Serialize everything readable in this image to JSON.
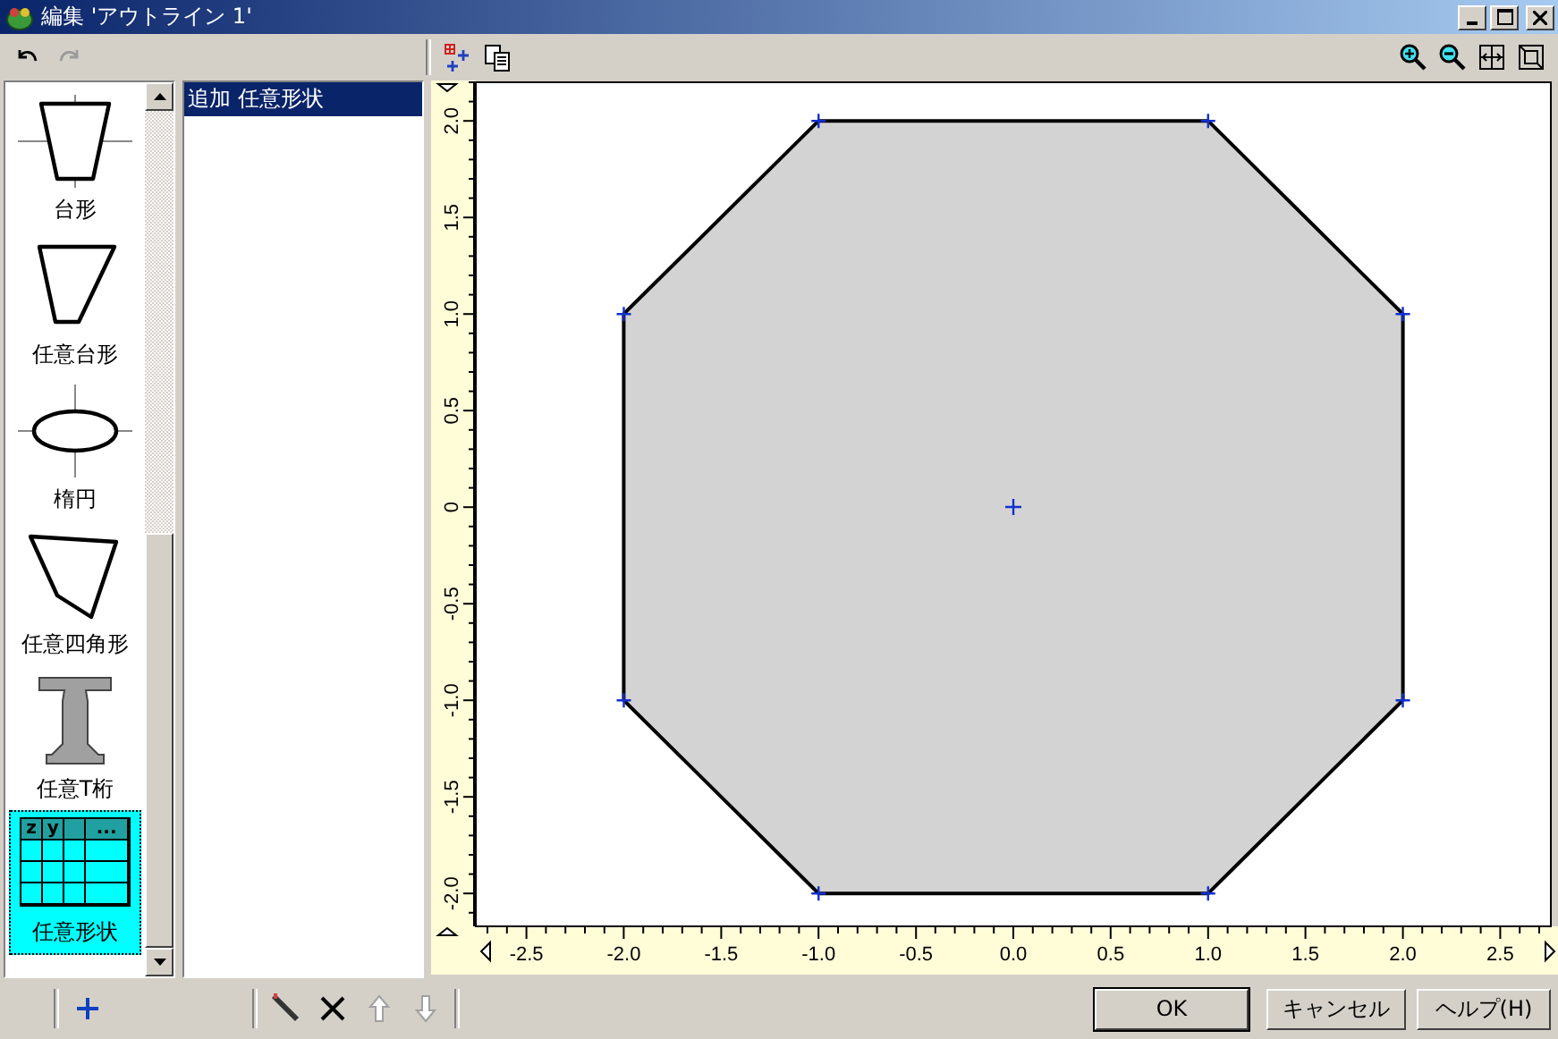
{
  "window": {
    "title": "編集 'アウトライン 1'"
  },
  "toolbar_left": [
    {
      "kind": "undo",
      "disabled": false
    },
    {
      "kind": "redo",
      "disabled": true
    }
  ],
  "palette": {
    "items": [
      {
        "kind": "trapezoid",
        "label": "台形",
        "selected": false
      },
      {
        "kind": "free-trapezoid",
        "label": "任意台形",
        "selected": false
      },
      {
        "kind": "ellipse",
        "label": "楕円",
        "selected": false
      },
      {
        "kind": "quad",
        "label": "任意四角形",
        "selected": false
      },
      {
        "kind": "t-girder",
        "label": "任意T桁",
        "selected": false
      },
      {
        "kind": "table",
        "label": "任意形状",
        "selected": true,
        "header": [
          "z",
          "y",
          "..."
        ]
      }
    ]
  },
  "list": {
    "items": [
      {
        "label": "追加 任意形状",
        "selected": true
      }
    ]
  },
  "canvas": {
    "chart_data": {
      "type": "area",
      "x": [
        -1,
        1,
        2,
        2,
        1,
        -1,
        -2,
        -2,
        -1
      ],
      "series": [
        {
          "color": "#000000",
          "values": [
            2,
            2,
            1,
            -1,
            -2,
            -2,
            -1,
            1,
            2
          ]
        }
      ],
      "xlim": [
        -2.76,
        2.76
      ],
      "ylim": [
        -2.17,
        2.2
      ],
      "xticks": [
        {
          "value": -2.5,
          "label": "-2.5"
        },
        {
          "value": -2,
          "label": "-2.0"
        },
        {
          "value": -1.5,
          "label": "-1.5"
        },
        {
          "value": -1,
          "label": "-1.0"
        },
        {
          "value": -0.5,
          "label": "-0.5"
        },
        {
          "value": 0,
          "label": "0.0"
        },
        {
          "value": 0.5,
          "label": "0.5"
        },
        {
          "value": 1,
          "label": "1.0"
        },
        {
          "value": 1.5,
          "label": "1.5"
        },
        {
          "value": 2,
          "label": "2.0"
        },
        {
          "value": 2.5,
          "label": "2.5"
        }
      ],
      "yticks": [
        {
          "value": 2,
          "label": "2.0"
        },
        {
          "value": 1.5,
          "label": "1.5"
        },
        {
          "value": 1,
          "label": "1.0"
        },
        {
          "value": 0.5,
          "label": "0.5"
        },
        {
          "value": 0,
          "label": "0"
        },
        {
          "value": -0.5,
          "label": "-0.5"
        },
        {
          "value": -1,
          "label": "-1.0"
        },
        {
          "value": -1.5,
          "label": "-1.5"
        },
        {
          "value": -2,
          "label": "-2.0"
        }
      ]
    }
  },
  "bottom_tools": [
    {
      "kind": "add",
      "disabled": false
    },
    {
      "kind": "edit",
      "disabled": false
    },
    {
      "kind": "delete",
      "disabled": false
    },
    {
      "kind": "up",
      "disabled": true
    },
    {
      "kind": "down",
      "disabled": true
    }
  ],
  "buttons": [
    {
      "label": "OK",
      "default": true
    },
    {
      "label": "キャンセル",
      "default": false
    },
    {
      "label": "ヘルプ(H)",
      "default": false
    }
  ]
}
